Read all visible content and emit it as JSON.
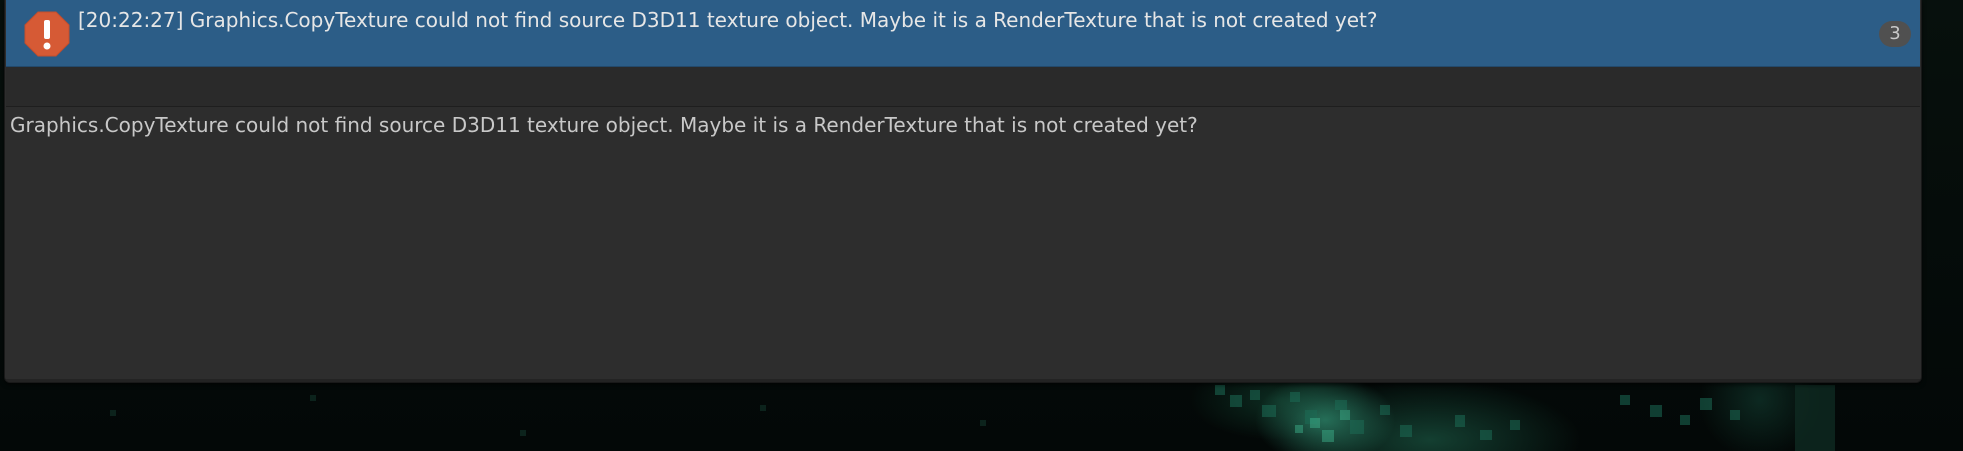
{
  "console": {
    "selected_entry": {
      "icon": "error-icon",
      "timestamp": "[20:22:27]",
      "message": "[20:22:27] Graphics.CopyTexture could not find source D3D11 texture object. Maybe it is a RenderTexture that is not created yet?",
      "count": "3"
    },
    "detail": {
      "text": "Graphics.CopyTexture could not find source D3D11 texture object. Maybe it is a RenderTexture that is not created yet?"
    }
  },
  "colors": {
    "selection": "#2c5d87",
    "error_icon": "#d65a35",
    "panel": "#2d2d2d"
  }
}
